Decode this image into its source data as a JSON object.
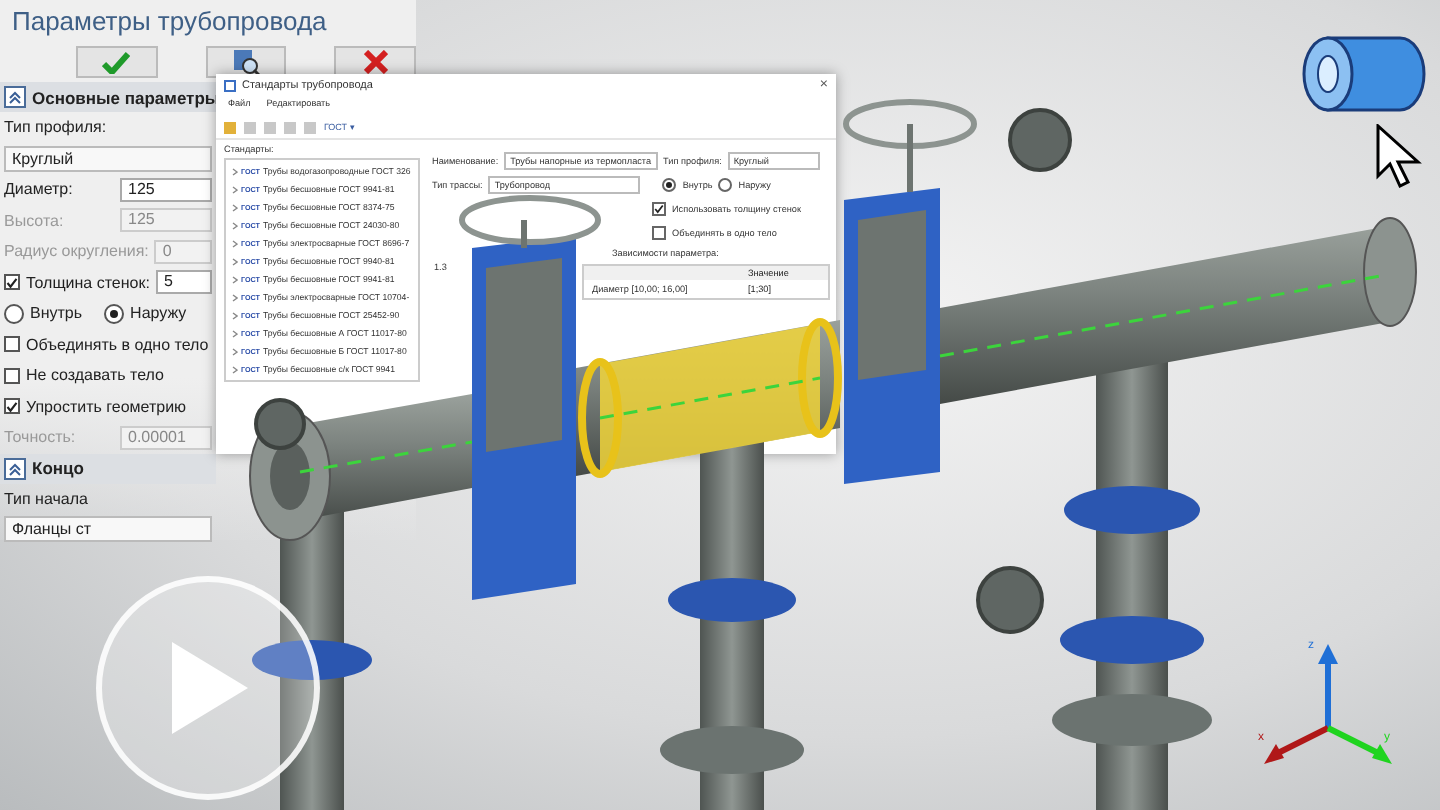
{
  "left_panel": {
    "title": "Параметры трубопровода",
    "buttons": [
      {
        "kind": "ok"
      },
      {
        "kind": "preview"
      },
      {
        "kind": "cancel"
      }
    ],
    "section": {
      "label": "Основные параметры",
      "expanded": true
    },
    "rows": [
      {
        "kind": "label",
        "label": "Тип профиля:"
      },
      {
        "kind": "dropdown",
        "value": "Круглый"
      },
      {
        "kind": "field",
        "label": "Диаметр:",
        "value": "125",
        "disabled": false
      },
      {
        "kind": "field",
        "label": "Высота:",
        "value": "125",
        "disabled": true
      },
      {
        "kind": "field",
        "label": "Радиус округления:",
        "value": "0",
        "disabled": true
      },
      {
        "kind": "checkfield",
        "label": "Толщина стенок:",
        "value": "5",
        "checked": true
      },
      {
        "kind": "radios",
        "options": [
          {
            "label": "Внутрь",
            "selected": false
          },
          {
            "label": "Наружу",
            "selected": true
          }
        ]
      },
      {
        "kind": "checkbox",
        "label": "Объединять в одно тело",
        "checked": false
      },
      {
        "kind": "checkbox",
        "label": "Не создавать тело",
        "checked": false
      },
      {
        "kind": "checkbox",
        "label": "Упростить геометрию",
        "checked": true
      },
      {
        "kind": "field",
        "label": "Точность:",
        "value": "0.00001",
        "disabled": true
      },
      {
        "kind": "section",
        "label": "Концо",
        "expanded": true
      },
      {
        "kind": "label",
        "label": "Тип начала"
      },
      {
        "kind": "dropdown",
        "value": "Фланцы ст"
      }
    ]
  },
  "dialog": {
    "title": "Стандарты трубопровода",
    "close": "×",
    "menu": [
      "Файл",
      "Редактировать"
    ],
    "toolbar_dropdown": "ГОСТ ▾",
    "list_label": "Стандарты:",
    "standards": [
      {
        "badge": "ГОСТ",
        "label": "Трубы водогазопроводные ГОСТ 326"
      },
      {
        "badge": "ГОСТ",
        "label": "Трубы бесшовные ГОСТ 9941-81"
      },
      {
        "badge": "ГОСТ",
        "label": "Трубы бесшовные ГОСТ 8374-75"
      },
      {
        "badge": "ГОСТ",
        "label": "Трубы бесшовные ГОСТ 24030-80"
      },
      {
        "badge": "ГОСТ",
        "label": "Трубы электросварные ГОСТ 8696-7"
      },
      {
        "badge": "ГОСТ",
        "label": "Трубы бесшовные ГОСТ 9940-81"
      },
      {
        "badge": "ГОСТ",
        "label": "Трубы бесшовные ГОСТ 9941-81"
      },
      {
        "badge": "ГОСТ",
        "label": "Трубы электросварные ГОСТ 10704-"
      },
      {
        "badge": "ГОСТ",
        "label": "Трубы бесшовные ГОСТ 25452-90"
      },
      {
        "badge": "ГОСТ",
        "label": "Трубы бесшовные А ГОСТ 11017-80"
      },
      {
        "badge": "ГОСТ",
        "label": "Трубы бесшовные Б ГОСТ 11017-80"
      },
      {
        "badge": "ГОСТ",
        "label": "Трубы бесшовные с/к ГОСТ 9941"
      }
    ],
    "name_label": "Наименование:",
    "name_value": "Трубы напорные из термопласта",
    "profile_label": "Тип профиля:",
    "profile_value": "Круглый",
    "route_label": "Тип трассы:",
    "route_value": "Трубопровод",
    "radios": [
      {
        "label": "Внутрь",
        "selected": true
      },
      {
        "label": "Наружу",
        "selected": false
      }
    ],
    "checks": [
      {
        "label": "Использовать толщину стенок",
        "checked": true
      },
      {
        "label": "Объединять в одно тело",
        "checked": false
      }
    ],
    "deps_label": "Зависимости параметра:",
    "table": {
      "value_header": "Значение",
      "rows": [
        {
          "name": "Диаметр [10,00; 16,00]",
          "value": "[1;30]"
        }
      ]
    },
    "side_value": "1.3"
  },
  "axes": [
    {
      "kind": "z",
      "label": "z"
    },
    {
      "kind": "x",
      "label": "x"
    },
    {
      "kind": "y",
      "label": "y"
    }
  ]
}
